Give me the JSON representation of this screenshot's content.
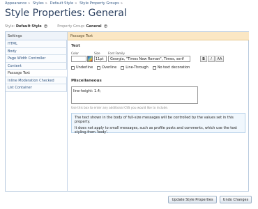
{
  "breadcrumb": [
    "Appearance",
    "Styles",
    "Default Style",
    "Style Property Groups"
  ],
  "page_title": "Style Properties: General",
  "filters": {
    "style_label": "Style:",
    "style_value": "Default Style",
    "group_label": "Property Group:",
    "group_value": "General"
  },
  "sidebar": {
    "header": "Settings",
    "items": [
      {
        "label": "HTML"
      },
      {
        "label": "Body"
      },
      {
        "label": "Page Width Controller"
      },
      {
        "label": "Content"
      },
      {
        "label": "Passage Text",
        "active": true
      },
      {
        "label": "Inline Moderation Checked"
      },
      {
        "label": "List Container"
      }
    ]
  },
  "editor": {
    "section_title": "Passage Text",
    "text_group": "Text",
    "color_label": "Color",
    "size_label": "Size",
    "font_family_label": "Font Family",
    "size_value": "11pt",
    "font_family_value": "Georgia, \"Times New Roman\", Times, serif",
    "bold_label": "B",
    "italic_label": "I",
    "aa_label": "AA",
    "decorations": {
      "underline": "Underline",
      "overline": "Overline",
      "line_through": "Line-Through",
      "none": "No text decoration"
    },
    "misc_group": "Miscellaneous",
    "css_value": "line-height: 1.4;",
    "css_hint": "Use this box to enter any additional CSS you would like to include.",
    "explain_1": "The text shown in the body of full-size messages will be controlled by the values set in this property.",
    "explain_2": "It does not apply to small messages, such as profile posts and comments, which use the text styling from 'body'."
  },
  "buttons": {
    "update": "Update Style Properties",
    "undo": "Undo Changes"
  },
  "colors": {
    "accent_bar": "#fbe7c4",
    "title": "#2a3f5f",
    "link": "#3b5f8a"
  }
}
